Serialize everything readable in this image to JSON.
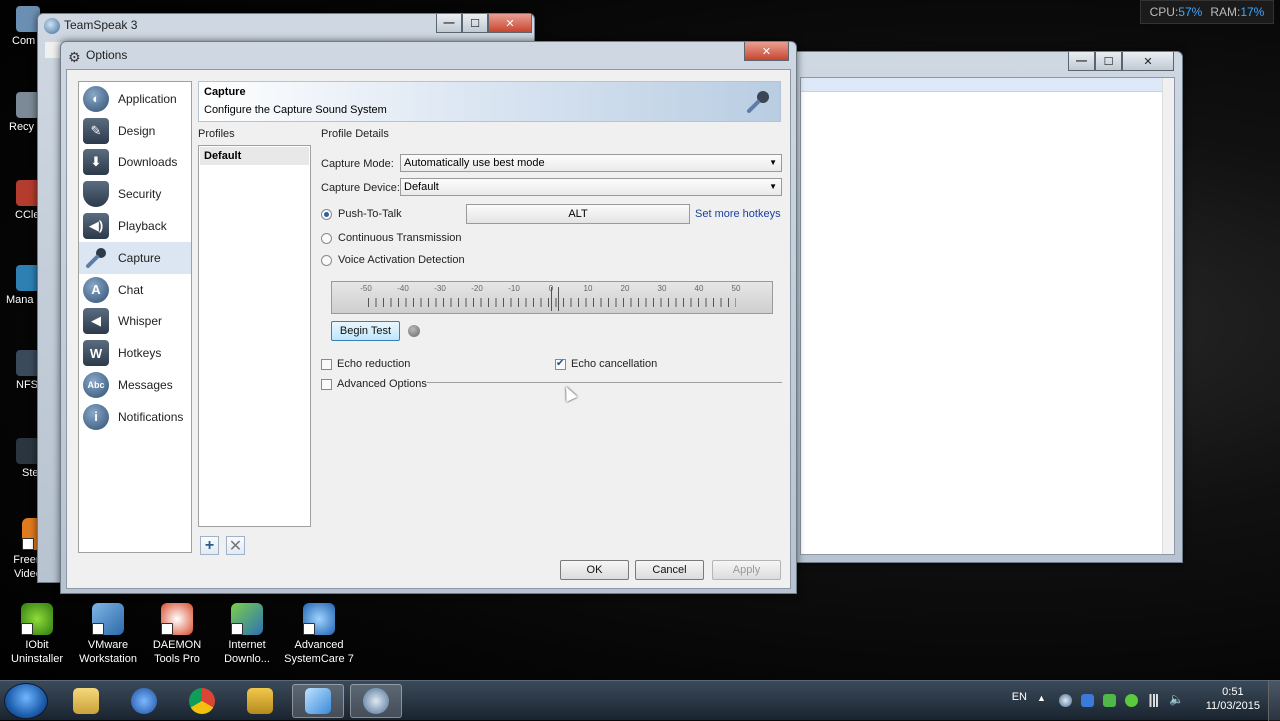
{
  "sysmon": {
    "cpu_label": "CPU:",
    "cpu_value": "57%",
    "ram_label": "RAM:",
    "ram_value": "17%"
  },
  "desktop_left": [
    "Com",
    "Recy",
    "CCle",
    "Mana",
    "NFS",
    "Ste",
    "Freemake Video C..."
  ],
  "desktop_icons": [
    {
      "line1": "IObit",
      "line2": "Uninstaller"
    },
    {
      "line1": "VMware",
      "line2": "Workstation"
    },
    {
      "line1": "DAEMON",
      "line2": "Tools Pro"
    },
    {
      "line1": "Internet",
      "line2": "Downlo..."
    },
    {
      "line1": "Advanced",
      "line2": "SystemCare 7"
    }
  ],
  "ts_window": {
    "title": "TeamSpeak 3"
  },
  "options": {
    "title": "Options",
    "nav": [
      {
        "label": "Application",
        "icon": "teamspeak-icon"
      },
      {
        "label": "Design",
        "icon": "design-icon"
      },
      {
        "label": "Downloads",
        "icon": "download-icon"
      },
      {
        "label": "Security",
        "icon": "shield-icon"
      },
      {
        "label": "Playback",
        "icon": "speaker-icon"
      },
      {
        "label": "Capture",
        "icon": "microphone-icon"
      },
      {
        "label": "Chat",
        "icon": "chat-icon"
      },
      {
        "label": "Whisper",
        "icon": "whisper-icon"
      },
      {
        "label": "Hotkeys",
        "icon": "hotkeys-icon"
      },
      {
        "label": "Messages",
        "icon": "messages-icon"
      },
      {
        "label": "Notifications",
        "icon": "info-icon"
      }
    ],
    "selected_nav": "Capture",
    "header": {
      "title": "Capture",
      "subtitle": "Configure the Capture Sound System"
    },
    "profiles_label": "Profiles",
    "profiles": [
      "Default"
    ],
    "details_label": "Profile Details",
    "capture_mode_label": "Capture Mode:",
    "capture_mode_value": "Automatically use best mode",
    "capture_device_label": "Capture Device:",
    "capture_device_value": "Default",
    "ptt_label": "Push-To-Talk",
    "ptt_hotkey": "ALT",
    "set_hotkeys_link": "Set more hotkeys",
    "continuous_label": "Continuous Transmission",
    "vad_label": "Voice Activation Detection",
    "slider_ticks": [
      "-50",
      "-40",
      "-30",
      "-20",
      "-10",
      "0",
      "10",
      "20",
      "30",
      "40",
      "50"
    ],
    "begin_test": "Begin Test",
    "echo_reduction": "Echo reduction",
    "echo_cancellation": "Echo cancellation",
    "advanced_options": "Advanced Options",
    "ok": "OK",
    "cancel": "Cancel",
    "apply": "Apply"
  },
  "taskbar": {
    "lang": "EN",
    "time": "0:51",
    "date": "11/03/2015"
  }
}
